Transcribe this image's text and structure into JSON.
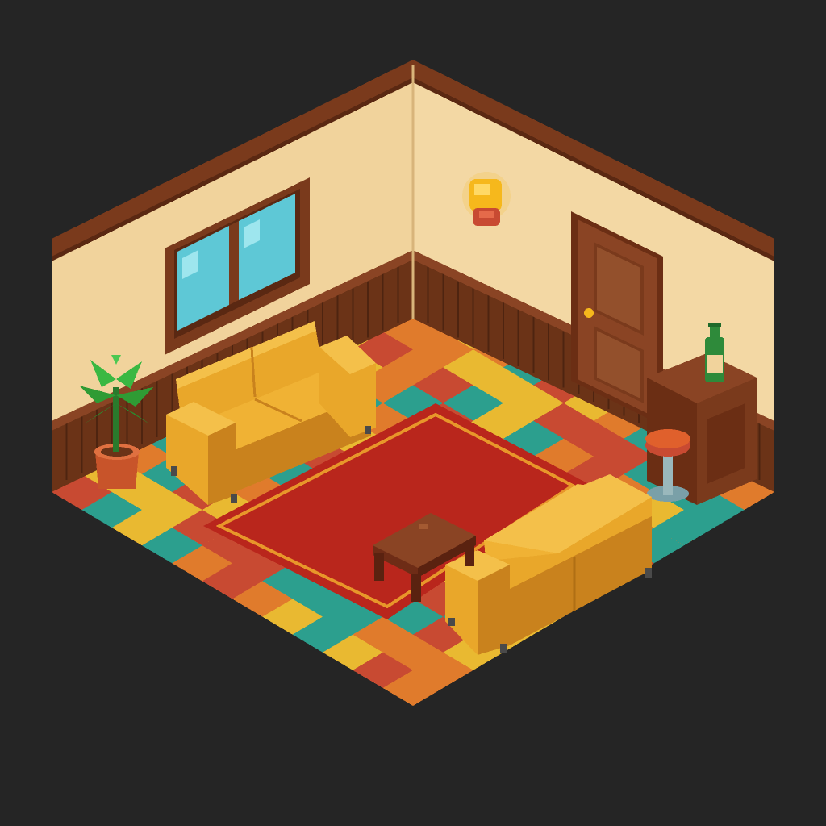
{
  "scene": {
    "type": "isometric pixel-art room",
    "background_color": "#252525"
  },
  "palette": {
    "wall_cream": "#f1d39c",
    "wall_shade": "#e6c28a",
    "trim_brown": "#7a3a1c",
    "wainscot_brown": "#6b3317",
    "floor_tiles": [
      "#2c9f8e",
      "#e07b2c",
      "#e9b931",
      "#c84a32"
    ],
    "rug_red": "#b9261c",
    "rug_border": "#e8962a",
    "sofa_yellow": "#e9a72a",
    "sofa_shade": "#c9821d",
    "table_brown": "#6e2c16",
    "door_brown": "#8a4424",
    "plant_green": "#2f9b34",
    "pot_orange": "#c8542a",
    "lamp_gold": "#f6b81c",
    "window_glass": "#5ec8d6",
    "bottle_green": "#2e8a3a"
  },
  "objects": [
    {
      "name": "window",
      "icon": "window-icon"
    },
    {
      "name": "wall-lamp",
      "icon": "lamp-icon"
    },
    {
      "name": "door",
      "icon": "door-icon"
    },
    {
      "name": "sofa-left",
      "icon": "sofa-icon"
    },
    {
      "name": "sofa-right",
      "icon": "sofa-icon"
    },
    {
      "name": "rug",
      "icon": "rug-icon"
    },
    {
      "name": "coffee-table",
      "icon": "table-icon"
    },
    {
      "name": "potted-plant",
      "icon": "plant-icon"
    },
    {
      "name": "side-cabinet",
      "icon": "cabinet-icon"
    },
    {
      "name": "bottle",
      "icon": "bottle-icon"
    },
    {
      "name": "bar-stool",
      "icon": "stool-icon"
    }
  ]
}
